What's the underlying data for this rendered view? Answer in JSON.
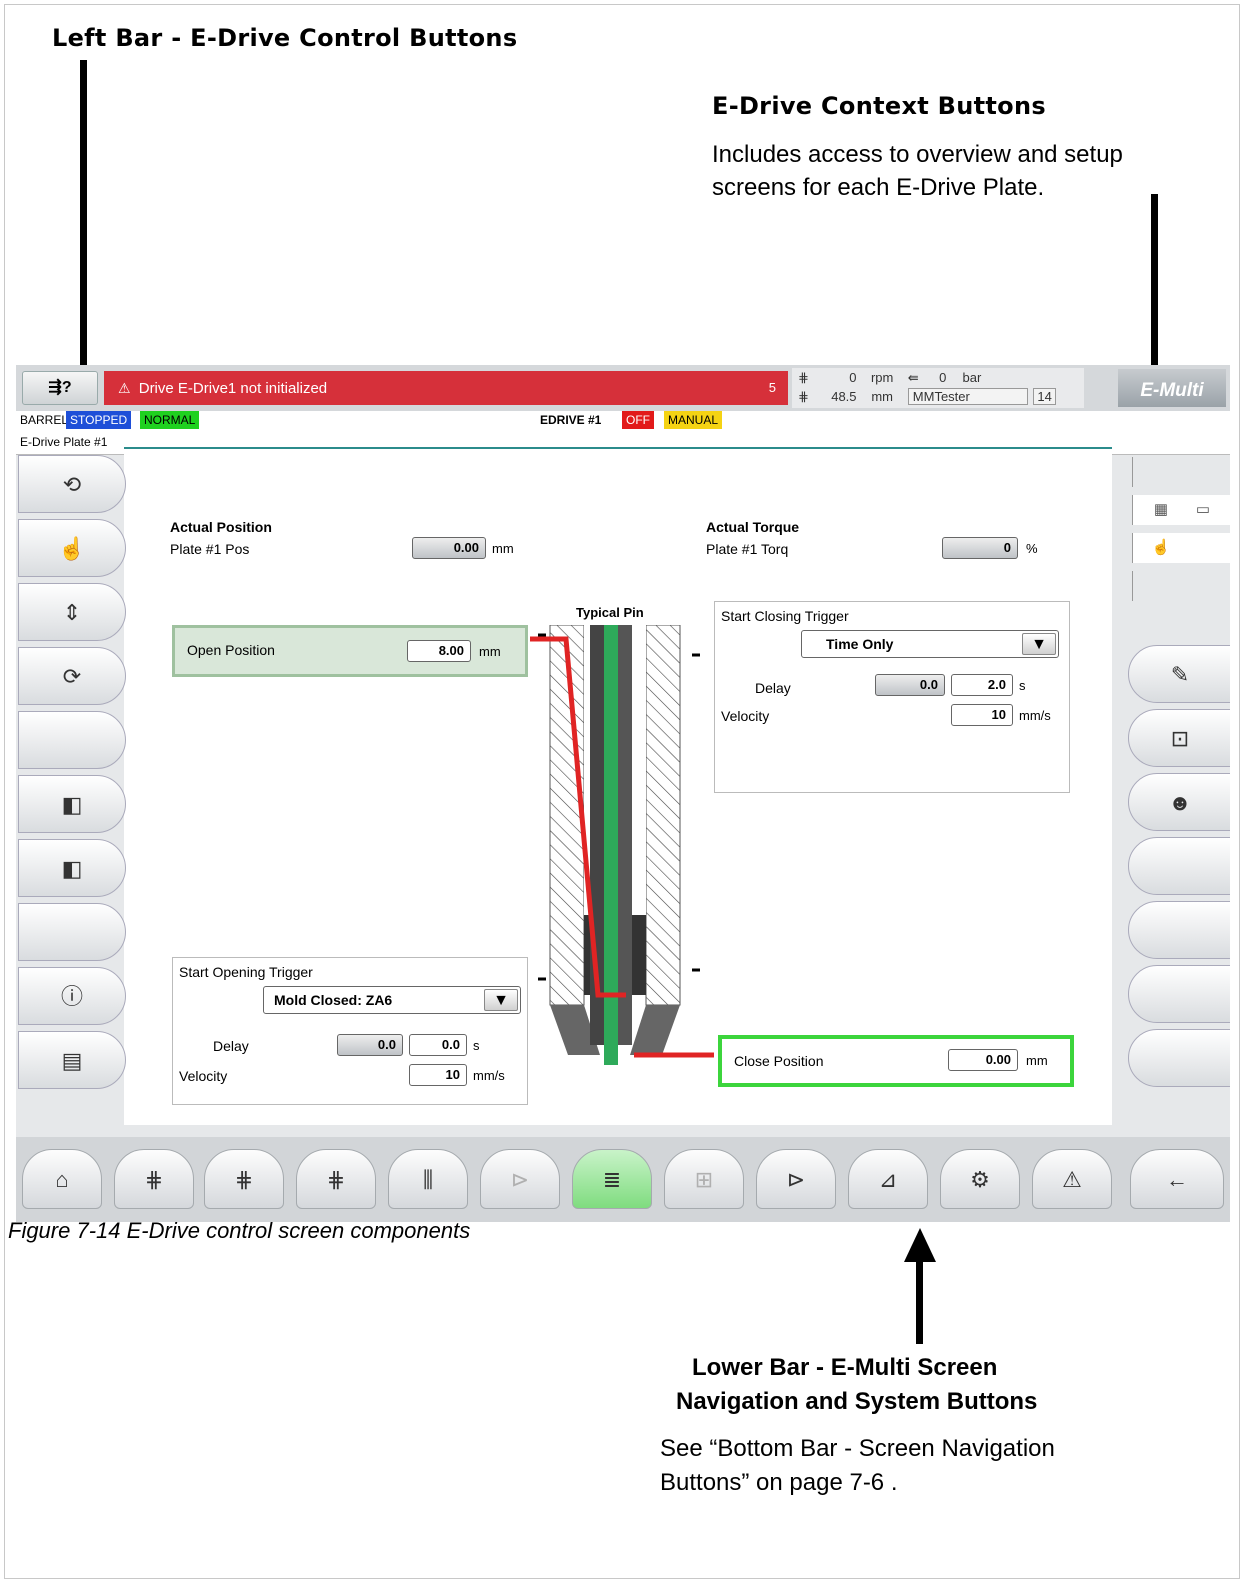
{
  "callouts": {
    "left_bar_title": "Left Bar - E-Drive Control Buttons",
    "context_title": "E-Drive Context Buttons",
    "context_text_1": "Includes access to overview and setup",
    "context_text_2": "screens for each E-Drive Plate.",
    "lower_title_1": "Lower Bar - E-Multi Screen",
    "lower_title_2": "Navigation and System Buttons",
    "lower_text_1": "See “Bottom Bar - Screen Navigation",
    "lower_text_2": "Buttons” on page 7-6 ."
  },
  "caption": "Figure 7-14 E-Drive control screen components",
  "topbar": {
    "alarm_text": "Drive E-Drive1 not initialized",
    "alarm_count": "5",
    "readout": {
      "r1_val1": "0",
      "r1_unit1": "rpm",
      "r1_val2": "0",
      "r1_unit2": "bar",
      "r2_val": "48.5",
      "r2_unit": "mm",
      "user": "MMTester",
      "num": "14"
    },
    "logo": "E-Multi",
    "accent_color": "#d6303a"
  },
  "statusbar": {
    "barrel": "BARREL",
    "stopped": "STOPPED",
    "normal": "NORMAL",
    "edrive": "EDRIVE #1",
    "off": "OFF",
    "manual": "MANUAL"
  },
  "screen": {
    "tab_title": "E-Drive Plate #1",
    "actual_position": "Actual Position",
    "plate_pos_label": "Plate #1 Pos",
    "plate_pos_value": "0.00",
    "plate_pos_unit": "mm",
    "actual_torque": "Actual Torque",
    "plate_torq_label": "Plate #1 Torq",
    "plate_torq_value": "0",
    "plate_torq_unit": "%",
    "typical_pin": "Typical Pin",
    "open_position_label": "Open Position",
    "open_position_value": "8.00",
    "open_position_unit": "mm",
    "close_position_label": "Close Position",
    "close_position_value": "0.00",
    "close_position_unit": "mm",
    "start_closing": {
      "title": "Start Closing Trigger",
      "mode": "Time Only",
      "delay_label": "Delay",
      "delay_actual": "0.0",
      "delay_set": "2.0",
      "delay_unit": "s",
      "velocity_label": "Velocity",
      "velocity_value": "10",
      "velocity_unit": "mm/s"
    },
    "start_opening": {
      "title": "Start Opening Trigger",
      "mode": "Mold Closed: ZA6",
      "delay_label": "Delay",
      "delay_actual": "0.0",
      "delay_set": "0.0",
      "delay_unit": "s",
      "velocity_label": "Velocity",
      "velocity_value": "10",
      "velocity_unit": "mm/s"
    }
  },
  "icons": {
    "left": [
      "cycle-icon",
      "hand-icon",
      "plate-actuate-icon",
      "auto-cycle-icon",
      "",
      "drive-back-icon",
      "drive-back-icon",
      "",
      "info-icon",
      "menu-icon"
    ],
    "right": [
      "notes-icon",
      "chart-user-icon",
      "user-icon"
    ],
    "bottom": [
      "home-icon",
      "zone-icon",
      "zone-multi-icon",
      "zone-icon",
      "sequence-icon",
      "timer-icon",
      "list-icon",
      "io-icon",
      "valve-icon",
      "graph-icon",
      "settings-icon",
      "alarm-icon",
      "back-icon"
    ]
  }
}
